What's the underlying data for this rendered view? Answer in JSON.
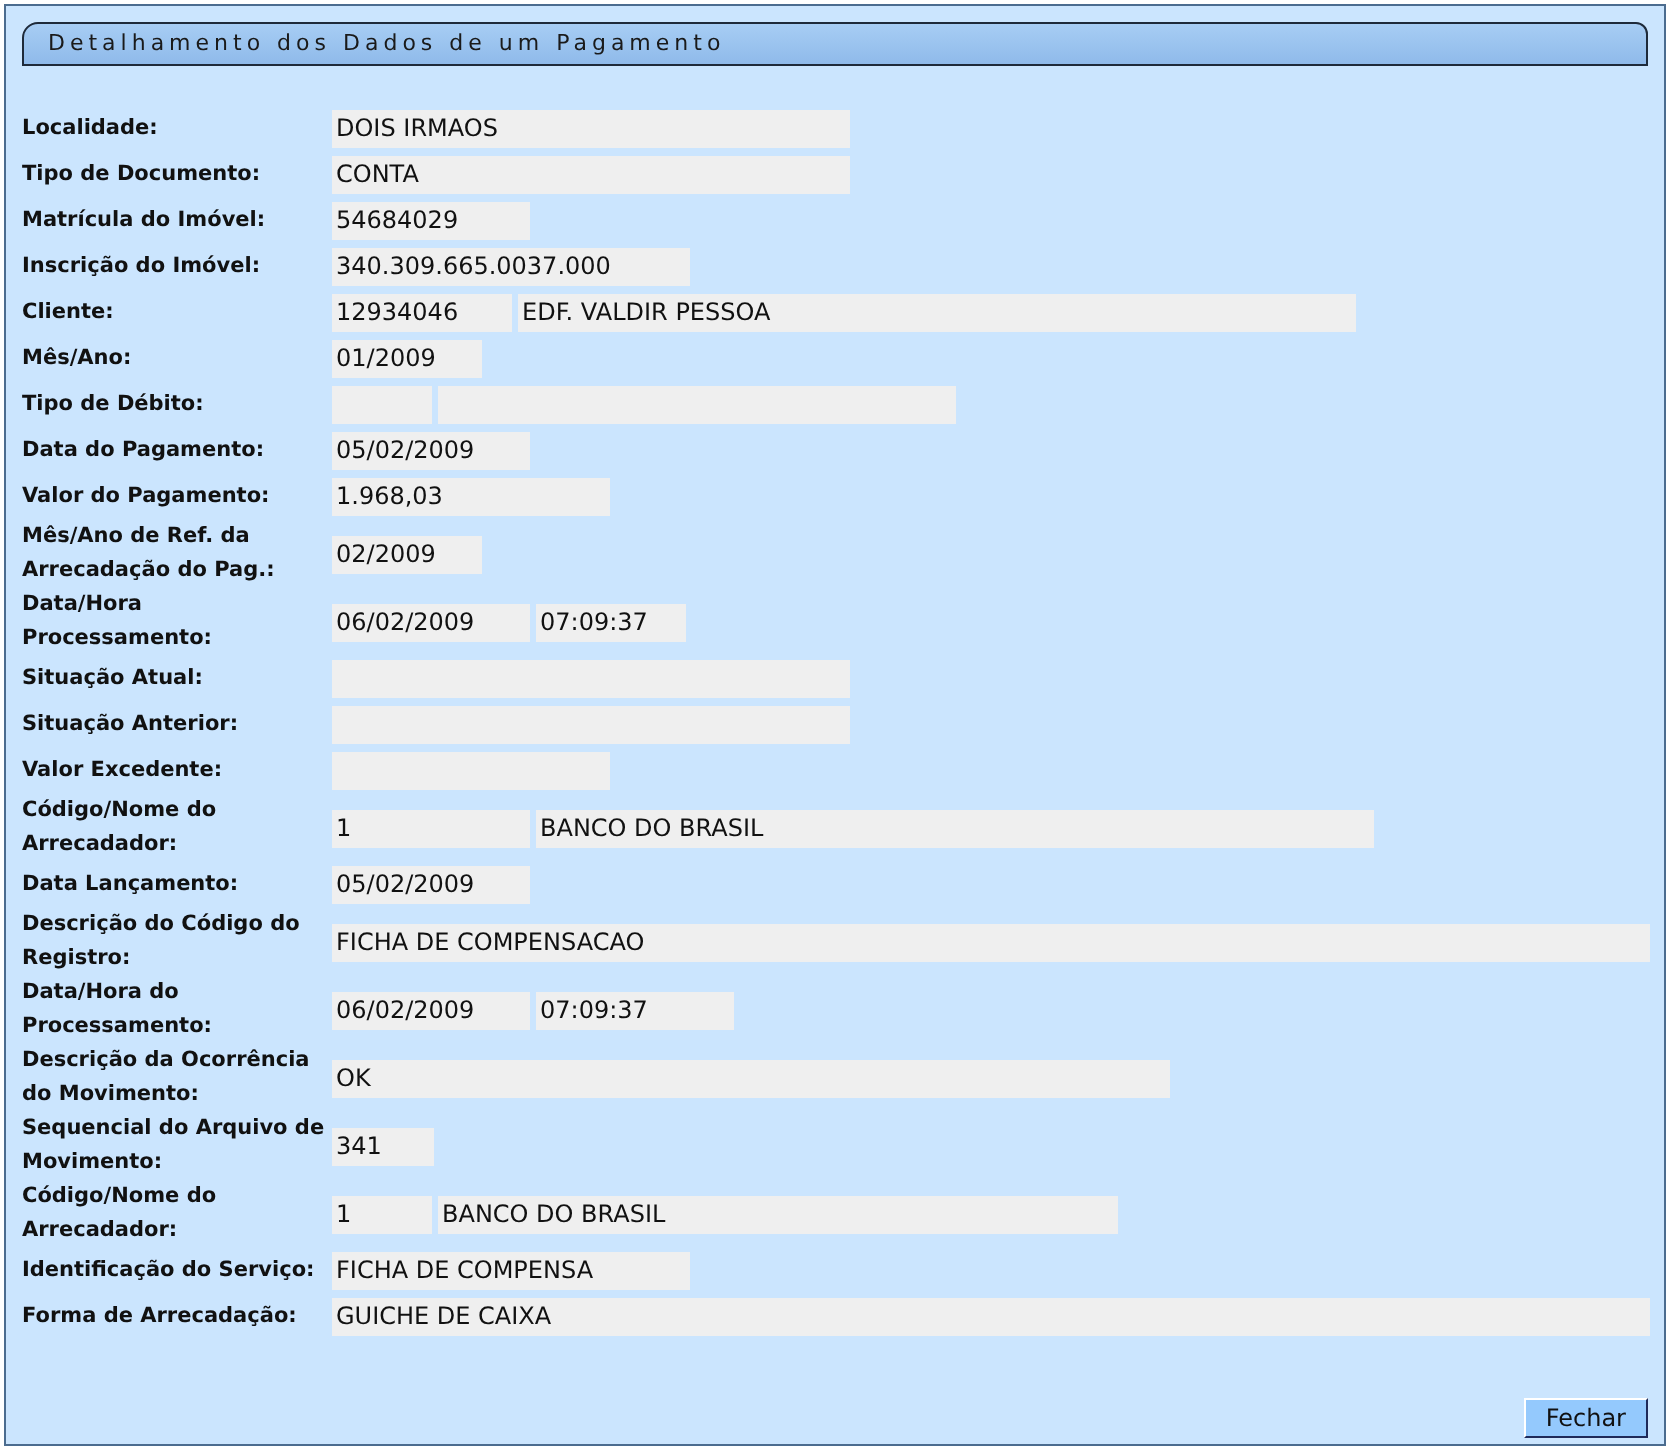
{
  "panel": {
    "title": "Detalhamento dos Dados de um Pagamento"
  },
  "rows": [
    {
      "label": "Localidade:",
      "fields": [
        {
          "kind": "text",
          "value": "DOIS IRMAOS"
        }
      ]
    },
    {
      "label": "Tipo de Documento:",
      "fields": [
        {
          "kind": "text",
          "value": "CONTA"
        }
      ]
    },
    {
      "label": "Matrícula do Imóvel:",
      "fields": [
        {
          "kind": "text",
          "value": "54684029"
        }
      ]
    },
    {
      "label": "Inscrição do Imóvel:",
      "fields": [
        {
          "kind": "text",
          "value": "340.309.665.0037.000"
        }
      ]
    },
    {
      "label": "Cliente:",
      "fields": [
        {
          "kind": "text",
          "value": "12934046"
        },
        {
          "kind": "text",
          "value": "EDF. VALDIR PESSOA"
        }
      ]
    },
    {
      "label": "Mês/Ano:",
      "fields": [
        {
          "kind": "text",
          "value": "01/2009"
        }
      ]
    },
    {
      "label": "Tipo de Débito:",
      "fields": [
        {
          "kind": "blank"
        },
        {
          "kind": "blank"
        }
      ]
    },
    {
      "label": "Data do Pagamento:",
      "fields": [
        {
          "kind": "text",
          "value": "05/02/2009"
        }
      ]
    },
    {
      "label": "Valor do Pagamento:",
      "fields": [
        {
          "kind": "text",
          "value": "1.968,03"
        }
      ]
    },
    {
      "label": "Mês/Ano de Ref. da Arrecadação do Pag.:",
      "fields": [
        {
          "kind": "text",
          "value": "02/2009"
        }
      ]
    },
    {
      "label": "Data/Hora Processamento:",
      "fields": [
        {
          "kind": "text",
          "value": "06/02/2009"
        },
        {
          "kind": "text",
          "value": "07:09:37"
        }
      ]
    },
    {
      "label": "Situação Atual:",
      "fields": [
        {
          "kind": "blank"
        }
      ]
    },
    {
      "label": "Situação Anterior:",
      "fields": [
        {
          "kind": "blank"
        }
      ]
    },
    {
      "label": "Valor Excedente:",
      "fields": [
        {
          "kind": "blank"
        }
      ]
    },
    {
      "label": "Código/Nome do Arrecadador:",
      "fields": [
        {
          "kind": "text",
          "value": "1"
        },
        {
          "kind": "text",
          "value": "BANCO DO BRASIL"
        }
      ]
    },
    {
      "label": "Data Lançamento:",
      "fields": [
        {
          "kind": "text",
          "value": "05/02/2009"
        }
      ]
    },
    {
      "label": "Descrição do Código do Registro:",
      "fields": [
        {
          "kind": "text",
          "value": "FICHA DE COMPENSACAO"
        }
      ]
    },
    {
      "label": "Data/Hora do Processamento:",
      "fields": [
        {
          "kind": "text",
          "value": "06/02/2009"
        },
        {
          "kind": "text",
          "value": "07:09:37"
        }
      ]
    },
    {
      "label": "Descrição da Ocorrência do Movimento:",
      "fields": [
        {
          "kind": "text",
          "value": "OK"
        }
      ]
    },
    {
      "label": "Sequencial do Arquivo de Movimento:",
      "fields": [
        {
          "kind": "text",
          "value": "341"
        }
      ]
    },
    {
      "label": "Código/Nome do Arrecadador:",
      "fields": [
        {
          "kind": "text",
          "value": "1"
        },
        {
          "kind": "text",
          "value": "BANCO DO BRASIL"
        }
      ]
    },
    {
      "label": "Identificação do Serviço:",
      "fields": [
        {
          "kind": "text",
          "value": "FICHA DE COMPENSA"
        }
      ]
    },
    {
      "label": "Forma de Arrecadação:",
      "fields": [
        {
          "kind": "text",
          "value": "GUICHE DE CAIXA"
        }
      ]
    }
  ],
  "buttons": [
    {
      "label": "Fechar"
    }
  ]
}
